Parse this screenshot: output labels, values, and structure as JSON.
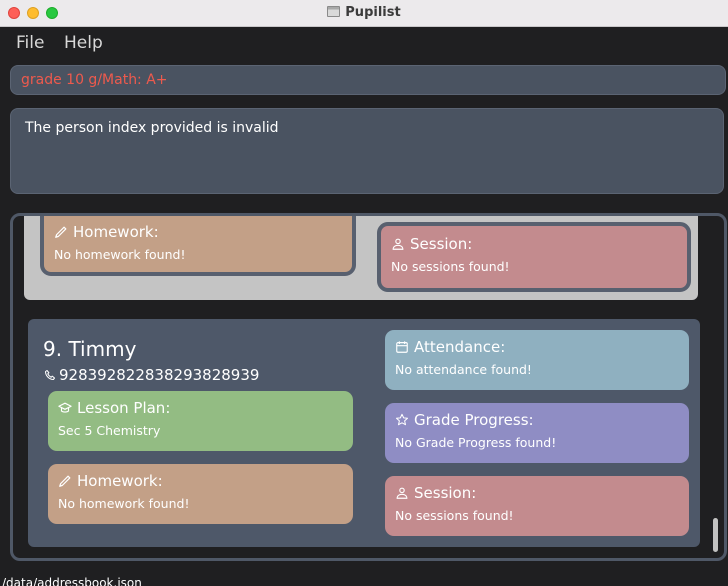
{
  "window": {
    "title": "Pupilist"
  },
  "menu": {
    "file": "File",
    "help": "Help"
  },
  "command": {
    "value": "grade 10 g/Math: A+"
  },
  "result": {
    "text": "The person index provided is invalid"
  },
  "selected_card": {
    "homework": {
      "title": "Homework:",
      "body": "No homework found!"
    },
    "session": {
      "title": "Session:",
      "body": "No sessions found!"
    }
  },
  "person": {
    "index_name": "9.  Timmy",
    "phone": "92839282283829382893​9",
    "lesson_plan": {
      "title": "Lesson Plan:",
      "body": "Sec 5 Chemistry"
    },
    "homework": {
      "title": "Homework:",
      "body": "No homework found!"
    },
    "attendance": {
      "title": "Attendance:",
      "body": "No attendance found!"
    },
    "grade_progress": {
      "title": "Grade Progress:",
      "body": "No Grade Progress found!"
    },
    "session": {
      "title": "Session:",
      "body": "No sessions found!"
    }
  },
  "status_bar": {
    "path": "/data/addressbook.json"
  },
  "colors": {
    "homework": "#c3a087",
    "session": "#c38b8e",
    "attendance": "#8fb0c0",
    "grade_progress": "#8f8dc4",
    "lesson_plan": "#93bc83",
    "command_text": "#ee5a4d"
  }
}
